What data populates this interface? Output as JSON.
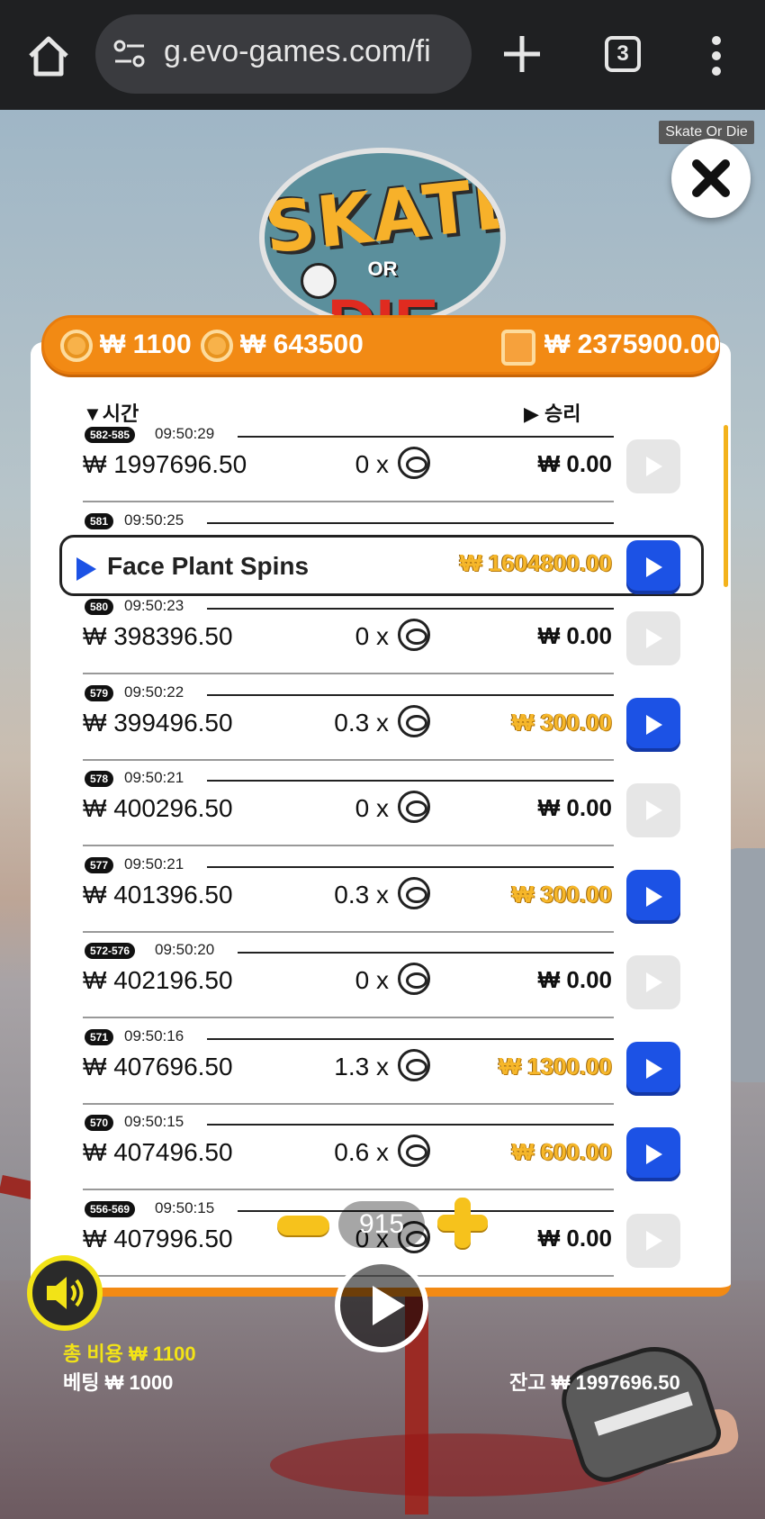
{
  "browser": {
    "url": "g.evo-games.com/fi",
    "tab_count": "3"
  },
  "game": {
    "title_tag": "Skate Or Die",
    "logo": {
      "line1": "SKATE",
      "line2": "OR",
      "line3": "DIE"
    }
  },
  "stats": {
    "bet_cost": "₩ 1100",
    "total_win": "₩ 643500",
    "wallet": "₩ 2375900.00"
  },
  "history": {
    "col_time": "▼시간",
    "col_win": "▶ 승리",
    "rows": [
      {
        "badge": "582-585",
        "time": "09:50:29",
        "balance": "₩ 1997696.50",
        "mult": "0 x",
        "win": "₩ 0.00",
        "gold": false,
        "replay": false
      },
      {
        "badge": "581",
        "time": "09:50:25",
        "feature": "Face Plant Spins",
        "win": "₩ 1604800.00",
        "gold": true,
        "replay": true
      },
      {
        "badge": "580",
        "time": "09:50:23",
        "balance": "₩ 398396.50",
        "mult": "0 x",
        "win": "₩ 0.00",
        "gold": false,
        "replay": false
      },
      {
        "badge": "579",
        "time": "09:50:22",
        "balance": "₩ 399496.50",
        "mult": "0.3 x",
        "win": "₩ 300.00",
        "gold": true,
        "replay": true
      },
      {
        "badge": "578",
        "time": "09:50:21",
        "balance": "₩ 400296.50",
        "mult": "0 x",
        "win": "₩ 0.00",
        "gold": false,
        "replay": false
      },
      {
        "badge": "577",
        "time": "09:50:21",
        "balance": "₩ 401396.50",
        "mult": "0.3 x",
        "win": "₩ 300.00",
        "gold": true,
        "replay": true
      },
      {
        "badge": "572-576",
        "time": "09:50:20",
        "balance": "₩ 402196.50",
        "mult": "0 x",
        "win": "₩ 0.00",
        "gold": false,
        "replay": false
      },
      {
        "badge": "571",
        "time": "09:50:16",
        "balance": "₩ 407696.50",
        "mult": "1.3 x",
        "win": "₩ 1300.00",
        "gold": true,
        "replay": true
      },
      {
        "badge": "570",
        "time": "09:50:15",
        "balance": "₩ 407496.50",
        "mult": "0.6 x",
        "win": "₩ 600.00",
        "gold": true,
        "replay": true
      },
      {
        "badge": "556-569",
        "time": "09:50:15",
        "balance": "₩ 407996.50",
        "mult": "0 x",
        "win": "₩ 0.00",
        "gold": false,
        "replay": false
      }
    ]
  },
  "controls": {
    "spin_count": "915"
  },
  "footer": {
    "total_cost": "총 비용  ₩ 1100",
    "bet": "베팅  ₩ 1000",
    "balance": "잔고  ₩ 1997696.50"
  },
  "colors": {
    "accent_orange": "#f28a14",
    "replay_blue": "#1c52e5",
    "win_gold": "#f6b72a"
  }
}
